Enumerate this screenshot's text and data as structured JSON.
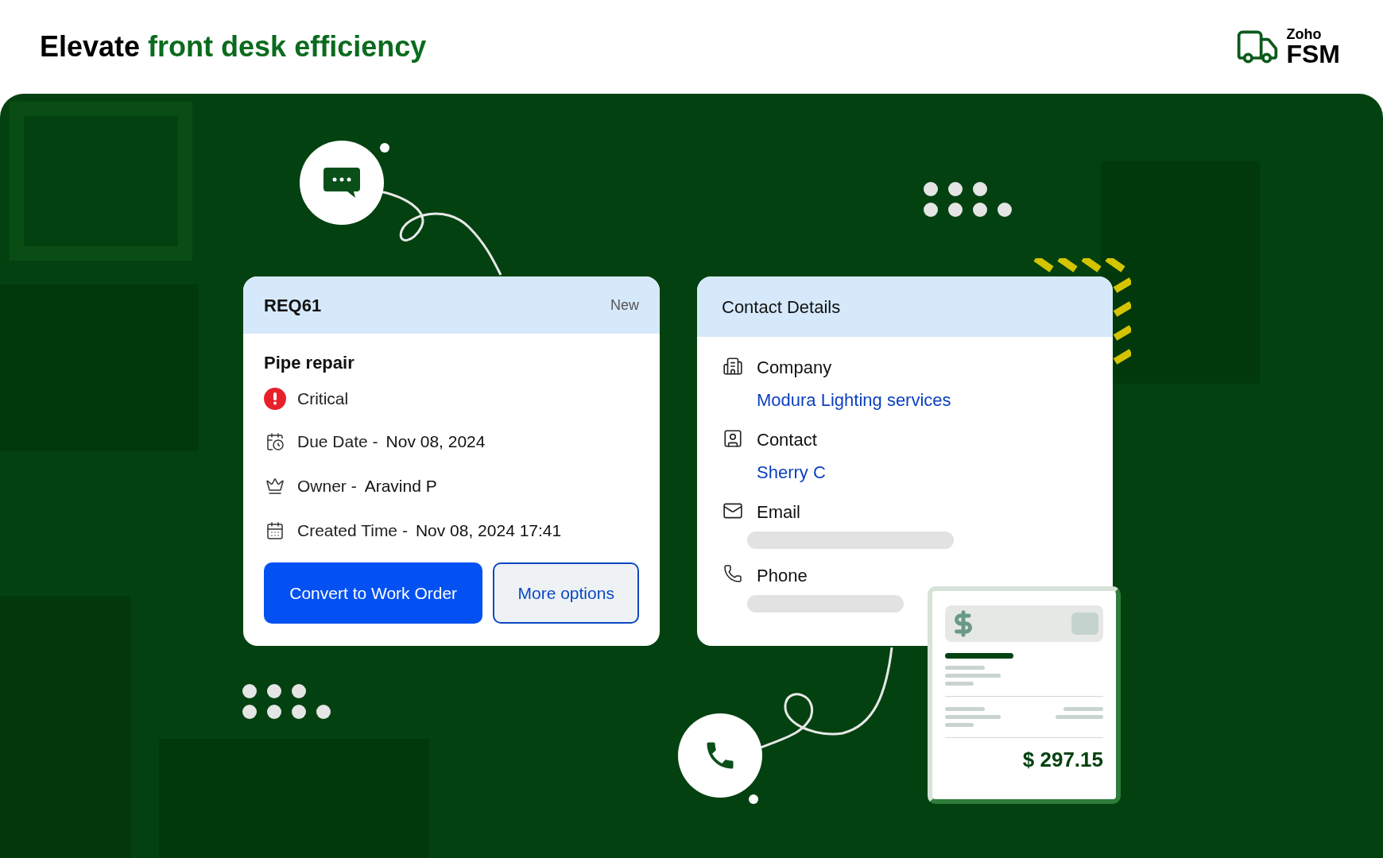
{
  "header": {
    "title_plain": "Elevate",
    "title_highlight": "front desk efficiency",
    "logo": {
      "small": "Zoho",
      "large": "FSM"
    }
  },
  "request_card": {
    "id": "REQ61",
    "status": "New",
    "subject": "Pipe repair",
    "priority": {
      "label": "Critical",
      "kind": "critical"
    },
    "fields": [
      {
        "kind": "due",
        "label": "Due Date -",
        "value": "Nov 08, 2024"
      },
      {
        "kind": "owner",
        "label": "Owner -",
        "value": "Aravind P"
      },
      {
        "kind": "created",
        "label": "Created Time -",
        "value": "Nov 08, 2024 17:41"
      }
    ],
    "buttons": [
      {
        "label": "Convert to Work Order",
        "kind": "primary"
      },
      {
        "label": "More options",
        "kind": "secondary"
      }
    ]
  },
  "contact_card": {
    "title": "Contact Details",
    "fields": [
      {
        "kind": "company",
        "label": "Company",
        "value": "Modura Lighting services"
      },
      {
        "kind": "contact",
        "label": "Contact",
        "value": "Sherry C"
      },
      {
        "kind": "email",
        "label": "Email"
      },
      {
        "kind": "phone",
        "label": "Phone"
      }
    ]
  },
  "invoice": {
    "amount": "$ 297.15"
  }
}
